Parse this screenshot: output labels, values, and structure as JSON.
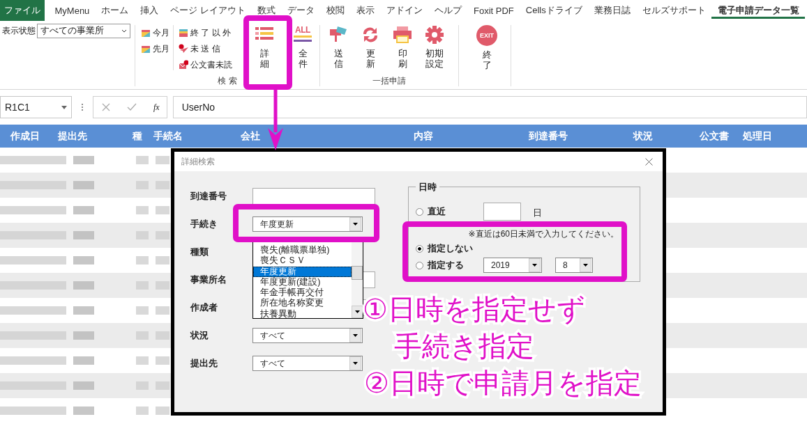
{
  "tabs": [
    {
      "label": "ファイル",
      "kind": "file",
      "selected": false
    },
    {
      "label": "MyMenu",
      "kind": "tab",
      "selected": false
    },
    {
      "label": "ホーム",
      "kind": "tab",
      "selected": false
    },
    {
      "label": "挿入",
      "kind": "tab",
      "selected": false
    },
    {
      "label": "ページ レイアウト",
      "kind": "tab",
      "selected": false
    },
    {
      "label": "数式",
      "kind": "tab",
      "selected": false
    },
    {
      "label": "データ",
      "kind": "tab",
      "selected": false
    },
    {
      "label": "校閲",
      "kind": "tab",
      "selected": false
    },
    {
      "label": "表示",
      "kind": "tab",
      "selected": false
    },
    {
      "label": "アドイン",
      "kind": "tab",
      "selected": false
    },
    {
      "label": "ヘルプ",
      "kind": "tab",
      "selected": false
    },
    {
      "label": "Foxit PDF",
      "kind": "tab",
      "selected": false
    },
    {
      "label": "Cellsドライブ",
      "kind": "tab",
      "selected": false
    },
    {
      "label": "業務日誌",
      "kind": "tab",
      "selected": false
    },
    {
      "label": "セルズサポート",
      "kind": "tab",
      "selected": false
    },
    {
      "label": "電子申請データ一覧",
      "kind": "tab",
      "selected": true
    }
  ],
  "ribbon": {
    "view_label": "表示状態",
    "view_value": "すべての事業所",
    "search_group": {
      "label": "検 索",
      "period_buttons": [
        {
          "label": "今月"
        },
        {
          "label": "先月"
        }
      ],
      "filter_buttons": [
        {
          "label": "終 了 以 外"
        },
        {
          "label": "未 送 信"
        },
        {
          "label": "公文書未読"
        }
      ],
      "large_buttons": [
        {
          "label": "詳細"
        },
        {
          "label": "全件",
          "icon_text": "ALL"
        }
      ]
    },
    "batch_group": {
      "label": "一括申請",
      "large_buttons": [
        {
          "label": "送信"
        },
        {
          "label": "更新"
        },
        {
          "label": "印刷"
        },
        {
          "label": "初期設定"
        }
      ]
    },
    "exit_button": {
      "label": "終了",
      "icon_text": "EXIT"
    }
  },
  "formula_bar": {
    "name_box": "R1C1",
    "function_label": "fx",
    "formula": "UserNo"
  },
  "sheet": {
    "columns": [
      "作成日",
      "提出先",
      "種",
      "手続名",
      "会社",
      "内容",
      "到達番号",
      "状況",
      "公文書",
      "処理日"
    ]
  },
  "dialog": {
    "title": "詳細検索",
    "fields": [
      {
        "label": "到達番号",
        "kind": "input"
      },
      {
        "label": "手続き",
        "kind": "combo",
        "value": "年度更新"
      },
      {
        "label": "種類",
        "kind": "none"
      },
      {
        "label": "事業所名",
        "kind": "input"
      },
      {
        "label": "作成者",
        "kind": "input"
      },
      {
        "label": "状況",
        "kind": "combo",
        "value": "すべて"
      },
      {
        "label": "提出先",
        "kind": "combo",
        "value": "すべて"
      }
    ],
    "dropdown": {
      "items": [
        {
          "label": "喪失(離職票単独)",
          "selected": false
        },
        {
          "label": "喪失ＣＳＶ",
          "selected": false
        },
        {
          "label": "年度更新",
          "selected": true
        },
        {
          "label": "年度更新(建設)",
          "selected": false
        },
        {
          "label": "年金手帳再交付",
          "selected": false
        },
        {
          "label": "所在地名称変更",
          "selected": false
        },
        {
          "label": "扶養異動",
          "selected": false
        }
      ]
    },
    "date_group": {
      "legend": "日時",
      "note": "※直近は60日未満で入力してください。",
      "options": [
        {
          "label": "直近",
          "kind": "days",
          "selected": false,
          "unit": "日"
        },
        {
          "label": "指定しない",
          "kind": "plain",
          "selected": true
        },
        {
          "label": "指定する",
          "kind": "month",
          "selected": false,
          "year": "2019",
          "month": "8"
        }
      ]
    }
  },
  "annotations": [
    {
      "text": "①日時を指定せず"
    },
    {
      "text": "手続き指定"
    },
    {
      "text": "②日時で申請月を指定"
    }
  ]
}
